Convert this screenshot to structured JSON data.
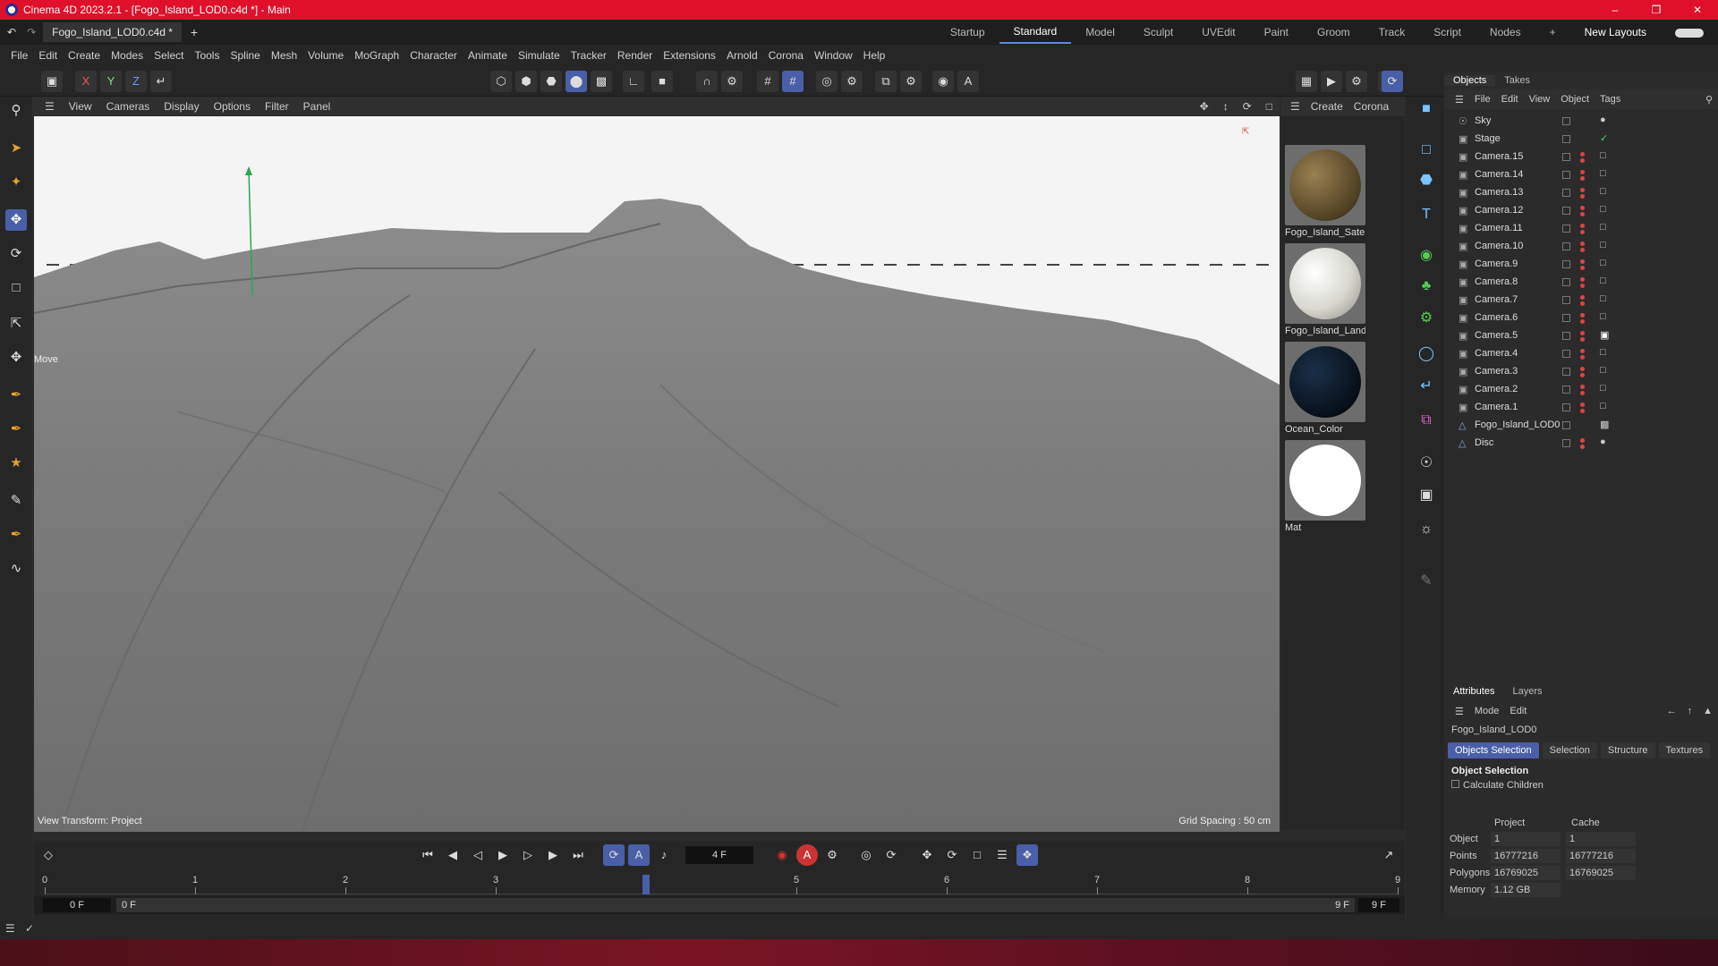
{
  "window": {
    "title": "Cinema 4D 2023.2.1 - [Fogo_Island_LOD0.c4d *] - Main"
  },
  "tabs": {
    "document": "Fogo_Island_LOD0.c4d *",
    "add": "+"
  },
  "layouts": {
    "items": [
      "Startup",
      "Standard",
      "Model",
      "Sculpt",
      "UVEdit",
      "Paint",
      "Groom",
      "Track",
      "Script",
      "Nodes"
    ],
    "add": "+",
    "new_layouts": "New Layouts"
  },
  "menu": [
    "File",
    "Edit",
    "Create",
    "Modes",
    "Select",
    "Tools",
    "Spline",
    "Mesh",
    "Volume",
    "MoGraph",
    "Character",
    "Animate",
    "Simulate",
    "Tracker",
    "Render",
    "Extensions",
    "Arnold",
    "Corona",
    "Window",
    "Help"
  ],
  "toolbar": {
    "x": "X",
    "y": "Y",
    "z": "Z"
  },
  "viewport": {
    "menu": [
      "View",
      "Cameras",
      "Display",
      "Options",
      "Filter",
      "Panel"
    ],
    "move_label": "Move",
    "view_transform": "View Transform: Project",
    "grid_spacing": "Grid Spacing : 50 cm"
  },
  "materials": {
    "menu": [
      "Create",
      "Corona"
    ],
    "items": [
      {
        "name": "Fogo_Island_Satel",
        "color": "#5a4a2a"
      },
      {
        "name": "Fogo_Island_Land",
        "color": "#d8d8d0"
      },
      {
        "name": "Ocean_Color",
        "color": "#0a1420"
      },
      {
        "name": "Mat",
        "color": "#ffffff"
      }
    ]
  },
  "objects_panel": {
    "tabs": [
      "Objects",
      "Takes"
    ],
    "menu": [
      "File",
      "Edit",
      "View",
      "Object",
      "Tags"
    ],
    "items": [
      {
        "name": "Sky",
        "icon": "sky-icon"
      },
      {
        "name": "Stage",
        "icon": "stage-icon"
      },
      {
        "name": "Camera.15",
        "icon": "camera-icon"
      },
      {
        "name": "Camera.14",
        "icon": "camera-icon"
      },
      {
        "name": "Camera.13",
        "icon": "camera-icon"
      },
      {
        "name": "Camera.12",
        "icon": "camera-icon"
      },
      {
        "name": "Camera.11",
        "icon": "camera-icon"
      },
      {
        "name": "Camera.10",
        "icon": "camera-icon"
      },
      {
        "name": "Camera.9",
        "icon": "camera-icon"
      },
      {
        "name": "Camera.8",
        "icon": "camera-icon"
      },
      {
        "name": "Camera.7",
        "icon": "camera-icon"
      },
      {
        "name": "Camera.6",
        "icon": "camera-icon"
      },
      {
        "name": "Camera.5",
        "icon": "camera-icon"
      },
      {
        "name": "Camera.4",
        "icon": "camera-icon"
      },
      {
        "name": "Camera.3",
        "icon": "camera-icon"
      },
      {
        "name": "Camera.2",
        "icon": "camera-icon"
      },
      {
        "name": "Camera.1",
        "icon": "camera-icon"
      },
      {
        "name": "Fogo_Island_LOD0",
        "icon": "polygon-object-icon"
      },
      {
        "name": "Disc",
        "icon": "polygon-object-icon"
      }
    ]
  },
  "attributes": {
    "tabs": [
      "Attributes",
      "Layers"
    ],
    "menu": [
      "Mode",
      "Edit"
    ],
    "object_name": "Fogo_Island_LOD0",
    "subtabs": [
      "Objects Selection",
      "Selection",
      "Structure",
      "Textures"
    ],
    "section": "Object Selection",
    "calculate_children": "Calculate Children",
    "col_project": "Project",
    "col_cache": "Cache",
    "rows": [
      {
        "label": "Object",
        "project": "1",
        "cache": "1"
      },
      {
        "label": "Points",
        "project": "16777216",
        "cache": "16777216"
      },
      {
        "label": "Polygons",
        "project": "16769025",
        "cache": "16769025"
      },
      {
        "label": "Memory",
        "project": "1.12 GB",
        "cache": ""
      }
    ]
  },
  "timeline": {
    "current_frame": "4 F",
    "ticks": [
      "0",
      "1",
      "2",
      "3",
      "4",
      "5",
      "6",
      "7",
      "8",
      "9"
    ],
    "current_tick": 4,
    "start": "0 F",
    "min": "0 F",
    "max": "9 F",
    "end": "9 F"
  }
}
